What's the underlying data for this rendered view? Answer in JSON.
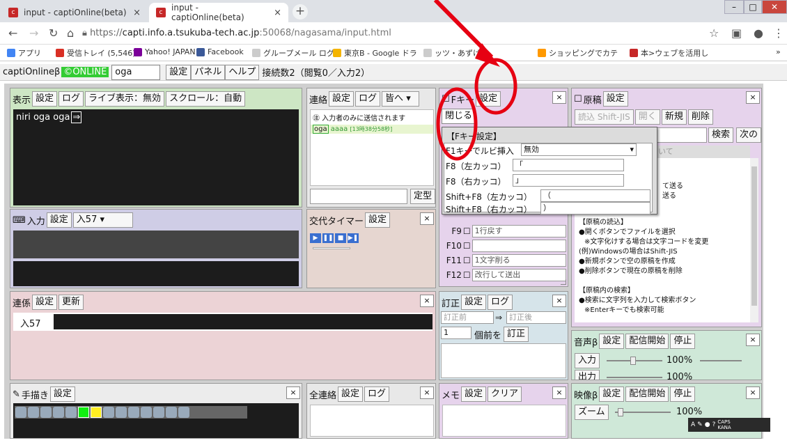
{
  "browser": {
    "tabs": [
      {
        "title": "input - captiOnline(beta)"
      },
      {
        "title": "input - captiOnline(beta)"
      }
    ],
    "new_tab": "+",
    "url_prefix": "https://",
    "url_host": "capti.info.a.tsukuba-tech.ac.jp",
    "url_rest": ":50068/nagasama/input.html",
    "bookmarks": [
      "アプリ",
      "受信トレイ (5,546)",
      "Yahoo! JAPAN",
      "Facebook",
      "グループメール ログ",
      "東京B - Google ドラ",
      "ッツ・あずけ〜",
      "ショッピングでカテ",
      "本>ウェブを活用し"
    ]
  },
  "toolbar": {
    "app_name": "captiOnlineβ",
    "status": "©ONLINE",
    "user_value": "oga",
    "settings": "設定",
    "panel": "パネル",
    "help": "ヘルプ",
    "conn": "接続数2（閲覧0／入力2）"
  },
  "display": {
    "title": "表示",
    "settings": "設定",
    "log": "ログ",
    "live": "ライブ表示：無効",
    "scroll": "スクロール：自動",
    "content": "niri oga oga"
  },
  "contact": {
    "title": "連絡",
    "settings": "設定",
    "log": "ログ",
    "target": "皆へ",
    "notice": "㊟ 入力者のみに送信されます",
    "msg_user": "oga",
    "msg_text": "aaaa",
    "msg_time": "[13時38分58秒]",
    "template": "定型"
  },
  "fkey": {
    "title": "Fキー",
    "settings": "設定",
    "close": "閉じる",
    "popup_title": "【Fキー設定】",
    "f1_label": "F1キーでルビ挿入",
    "f1_value": "無効",
    "f8l": "F8（左カッコ）",
    "f8l_v": "「",
    "f8r": "F8（右カッコ）",
    "f8r_v": "」",
    "sf8l": "Shift+F8（左カッコ）",
    "sf8l_v": "（",
    "sf8r": "Shift+F8（右カッコ）",
    "sf8r_v": "）",
    "rows": [
      {
        "key": "F9",
        "value": "1行戻す"
      },
      {
        "key": "F10",
        "value": ""
      },
      {
        "key": "F11",
        "value": "1文字削る"
      },
      {
        "key": "F12",
        "value": "改行して送出"
      }
    ]
  },
  "manuscript": {
    "title": "原稿",
    "settings": "設定",
    "read": "読込 Shift-JIS",
    "open": "開く",
    "new": "新規",
    "delete": "削除",
    "search_ph": "検索",
    "search": "検索",
    "next": "次の",
    "frag1": "いて",
    "frag2": "て送る",
    "frag3": "送る",
    "help_lines": [
      "【原稿の読込】",
      "●開くボタンでファイルを選択",
      "※文字化けする場合は文字コードを変更",
      "(例)Windowsの場合はShift-JIS",
      "●新規ボタンで空の原稿を作成",
      "●削除ボタンで現在の原稿を削除",
      "",
      "【原稿内の検索】",
      "●検索に文字列を入力して検索ボタン",
      "※Enterキーでも検索可能"
    ]
  },
  "input": {
    "title": "入力",
    "settings": "設定",
    "target": "入57"
  },
  "timer": {
    "title": "交代タイマー",
    "settings": "設定"
  },
  "coop": {
    "title": "連係",
    "settings": "設定",
    "update": "更新",
    "row_label": "入57"
  },
  "correction": {
    "title": "訂正",
    "settings": "設定",
    "log": "ログ",
    "before_ph": "訂正前",
    "arrow": "⇒",
    "after_ph": "訂正後",
    "count": "1",
    "before_label": "個前を",
    "correct": "訂正"
  },
  "audio": {
    "title": "音声β",
    "settings": "設定",
    "start": "配信開始",
    "stop": "停止",
    "in": "入力",
    "in_pct": "100%",
    "out": "出力",
    "out_pct": "100%"
  },
  "draw": {
    "title": "手描き",
    "settings": "設定"
  },
  "allcontact": {
    "title": "全連絡",
    "settings": "設定",
    "log": "ログ"
  },
  "memo": {
    "title": "メモ",
    "settings": "設定",
    "clear": "クリア"
  },
  "video": {
    "title": "映像β",
    "settings": "設定",
    "start": "配信開始",
    "stop": "停止",
    "zoom": "ズーム",
    "zoom_pct": "100%"
  },
  "ime": {
    "caps": "CAPS",
    "kana": "KANA"
  },
  "close_x": "×"
}
